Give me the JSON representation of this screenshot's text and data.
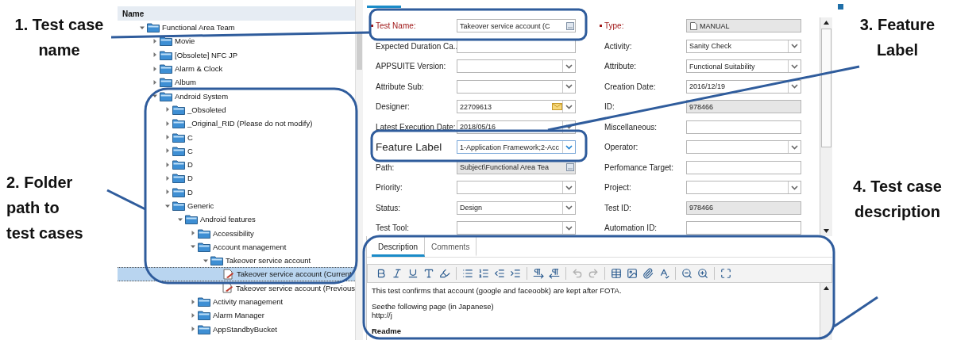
{
  "annotations": {
    "left": [
      {
        "text": "1. Test case name"
      },
      {
        "text": "2. Folder path to test cases"
      }
    ],
    "right": [
      {
        "text": "3. Feature Label"
      },
      {
        "text": "4. Test case description"
      }
    ]
  },
  "tree": {
    "header": "Name",
    "items": [
      {
        "label": "Functional Area Team",
        "kind": "folder",
        "expanded": true,
        "selected": false,
        "children": [
          {
            "label": "Movie",
            "kind": "folder",
            "expanded": false,
            "selected": false
          },
          {
            "label": "[Obsolete] NFC JP",
            "kind": "folder",
            "expanded": false,
            "selected": false
          },
          {
            "label": "Alarm & Clock",
            "kind": "folder",
            "expanded": false,
            "selected": false
          },
          {
            "label": "Album",
            "kind": "folder",
            "expanded": false,
            "selected": false
          },
          {
            "label": "Android System",
            "kind": "folder",
            "expanded": true,
            "selected": false,
            "children": [
              {
                "label": "_Obsoleted",
                "kind": "folder",
                "expanded": false,
                "selected": false
              },
              {
                "label": "_Original_RID (Please do not modify)",
                "kind": "folder",
                "expanded": false,
                "selected": false
              },
              {
                "label": "C",
                "kind": "folder",
                "expanded": false,
                "selected": false
              },
              {
                "label": "C",
                "kind": "folder",
                "expanded": false,
                "selected": false
              },
              {
                "label": "D",
                "kind": "folder",
                "expanded": false,
                "selected": false
              },
              {
                "label": "D",
                "kind": "folder",
                "expanded": false,
                "selected": false
              },
              {
                "label": "D",
                "kind": "folder",
                "expanded": false,
                "selected": false
              },
              {
                "label": "Generic",
                "kind": "folder",
                "expanded": true,
                "selected": false,
                "children": [
                  {
                    "label": "Android features",
                    "kind": "folder",
                    "expanded": true,
                    "selected": false,
                    "children": [
                      {
                        "label": "Accessibility",
                        "kind": "folder",
                        "expanded": false,
                        "selected": false
                      },
                      {
                        "label": "Account management",
                        "kind": "folder",
                        "expanded": true,
                        "selected": false,
                        "children": [
                          {
                            "label": "Takeover service account",
                            "kind": "folder",
                            "expanded": true,
                            "selected": false,
                            "children": [
                              {
                                "label": "Takeover service account (Current",
                                "kind": "test",
                                "selected": true
                              },
                              {
                                "label": "Takeover service account (Previous",
                                "kind": "test",
                                "selected": false
                              }
                            ]
                          }
                        ]
                      },
                      {
                        "label": "Activity management",
                        "kind": "folder",
                        "expanded": false,
                        "selected": false
                      },
                      {
                        "label": "Alarm Manager",
                        "kind": "folder",
                        "expanded": false,
                        "selected": false
                      },
                      {
                        "label": "AppStandbyBucket",
                        "kind": "folder",
                        "expanded": false,
                        "selected": false
                      }
                    ]
                  }
                ]
              }
            ]
          }
        ]
      }
    ]
  },
  "form": {
    "left": [
      {
        "label": "Test Name:",
        "required": true,
        "kind": "browse",
        "value": "Takeover service account (C"
      },
      {
        "label": "Expected  Duration  Ca..",
        "required": false,
        "kind": "text"
      },
      {
        "label": "APPSUITE Version:",
        "required": false,
        "kind": "select"
      },
      {
        "label": "Attribute Sub:",
        "required": false,
        "kind": "select"
      },
      {
        "label": "Designer:",
        "required": false,
        "kind": "mail",
        "value": "22709613"
      },
      {
        "label": "Latest Execution Date:",
        "required": false,
        "kind": "select",
        "value": "2018/05/16"
      },
      {
        "label": "Feature Label",
        "required": false,
        "kind": "select",
        "value": "1-Application Framework;2-Acc",
        "highlighted": true
      },
      {
        "label": "Path:",
        "required": false,
        "kind": "lockedbrowse",
        "value": "Subject\\Functional Area Tea"
      },
      {
        "label": "Priority:",
        "required": false,
        "kind": "select"
      },
      {
        "label": "Status:",
        "required": false,
        "kind": "select",
        "value": "Design"
      },
      {
        "label": "Test Tool:",
        "required": false,
        "kind": "select"
      }
    ],
    "right": [
      {
        "label": "Type:",
        "required": true,
        "kind": "doctype",
        "value": "MANUAL"
      },
      {
        "label": "Activity:",
        "required": false,
        "kind": "select",
        "value": "Sanity Check"
      },
      {
        "label": "Attribute:",
        "required": false,
        "kind": "select",
        "value": "Functional Suitability"
      },
      {
        "label": "Creation Date:",
        "required": false,
        "kind": "select",
        "value": "2016/12/19"
      },
      {
        "label": "ID:",
        "required": false,
        "kind": "readonly",
        "value": "978466"
      },
      {
        "label": "Miscellaneous:",
        "required": false,
        "kind": "text"
      },
      {
        "label": "Operator:",
        "required": false,
        "kind": "select"
      },
      {
        "label": "Perfomance Target:",
        "required": false,
        "kind": "text"
      },
      {
        "label": "Project:",
        "required": false,
        "kind": "select"
      },
      {
        "label": "Test ID:",
        "required": false,
        "kind": "readonly",
        "value": "978466"
      },
      {
        "label": "Automation ID:",
        "required": false,
        "kind": "text"
      }
    ]
  },
  "editor": {
    "tabs": [
      {
        "label": "Description",
        "selected": true
      },
      {
        "label": "Comments",
        "selected": false
      }
    ],
    "undo_enabled": false,
    "redo_enabled": false,
    "paragraphs": [
      {
        "text": "This test confirms that account (google and faceoobk) are kept after FOTA.",
        "bold": false
      },
      {
        "text": "Seethe following page (in Japanese)\nhttp://j",
        "bold": false
      },
      {
        "text": "Readme",
        "bold": true
      }
    ]
  }
}
